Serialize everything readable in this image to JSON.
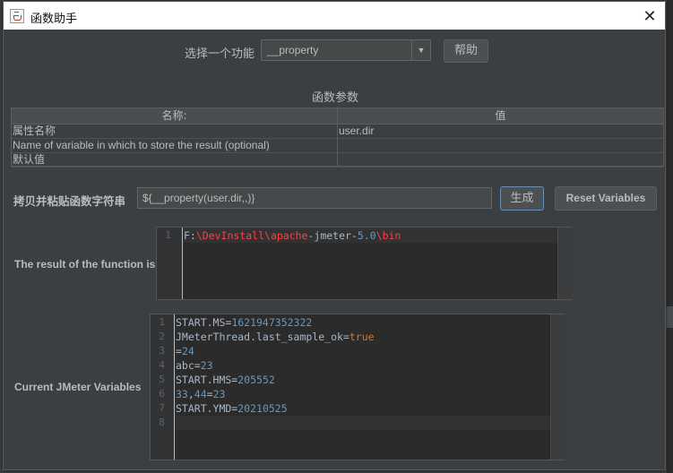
{
  "window": {
    "title": "函数助手"
  },
  "selector": {
    "label": "选择一个功能",
    "value": "__property",
    "help_label": "帮助"
  },
  "params": {
    "title": "函数参数",
    "headers": [
      "名称:",
      "值"
    ],
    "rows": [
      {
        "name": "属性名称",
        "value": "user.dir"
      },
      {
        "name": "Name of variable in which to store the result (optional)",
        "value": ""
      },
      {
        "name": "默认值",
        "value": ""
      }
    ]
  },
  "copy": {
    "label": "拷贝并粘贴函数字符串",
    "value": "${__property(user.dir,,)}",
    "generate_label": "生成",
    "reset_label": "Reset Variables"
  },
  "result": {
    "label": "The result of the function is",
    "line_number": "1",
    "tokens": [
      {
        "text": "F:",
        "style": "plain"
      },
      {
        "text": "\\DevInstall\\apache",
        "style": "red"
      },
      {
        "text": "-jmeter-",
        "style": "plain"
      },
      {
        "text": "5.0",
        "style": "num"
      },
      {
        "text": "\\bin",
        "style": "red"
      }
    ]
  },
  "variables": {
    "label": "Current JMeter Variables",
    "lines": [
      {
        "num": "1",
        "tokens": [
          {
            "text": "START.MS=",
            "style": "plain"
          },
          {
            "text": "1621947352322",
            "style": "num"
          }
        ]
      },
      {
        "num": "2",
        "tokens": [
          {
            "text": "JMeterThread.last_sample_ok=",
            "style": "plain"
          },
          {
            "text": "true",
            "style": "kw"
          }
        ]
      },
      {
        "num": "3",
        "tokens": [
          {
            "text": "=",
            "style": "plain"
          },
          {
            "text": "24",
            "style": "num"
          }
        ]
      },
      {
        "num": "4",
        "tokens": [
          {
            "text": "abc=",
            "style": "plain"
          },
          {
            "text": "23",
            "style": "num"
          }
        ]
      },
      {
        "num": "5",
        "tokens": [
          {
            "text": "START.HMS=",
            "style": "plain"
          },
          {
            "text": "205552",
            "style": "num"
          }
        ]
      },
      {
        "num": "6",
        "tokens": [
          {
            "text": "33",
            "style": "num"
          },
          {
            "text": ",",
            "style": "plain"
          },
          {
            "text": "44",
            "style": "num"
          },
          {
            "text": "=",
            "style": "plain"
          },
          {
            "text": "23",
            "style": "num"
          }
        ]
      },
      {
        "num": "7",
        "tokens": [
          {
            "text": "START.YMD=",
            "style": "plain"
          },
          {
            "text": "20210525",
            "style": "num"
          }
        ]
      },
      {
        "num": "8",
        "tokens": []
      }
    ]
  },
  "colors": {
    "background": "#3c3f41",
    "editor_bg": "#2b2b2b",
    "number": "#6897bb",
    "keyword": "#cc7832",
    "path_red": "#ff4040"
  }
}
